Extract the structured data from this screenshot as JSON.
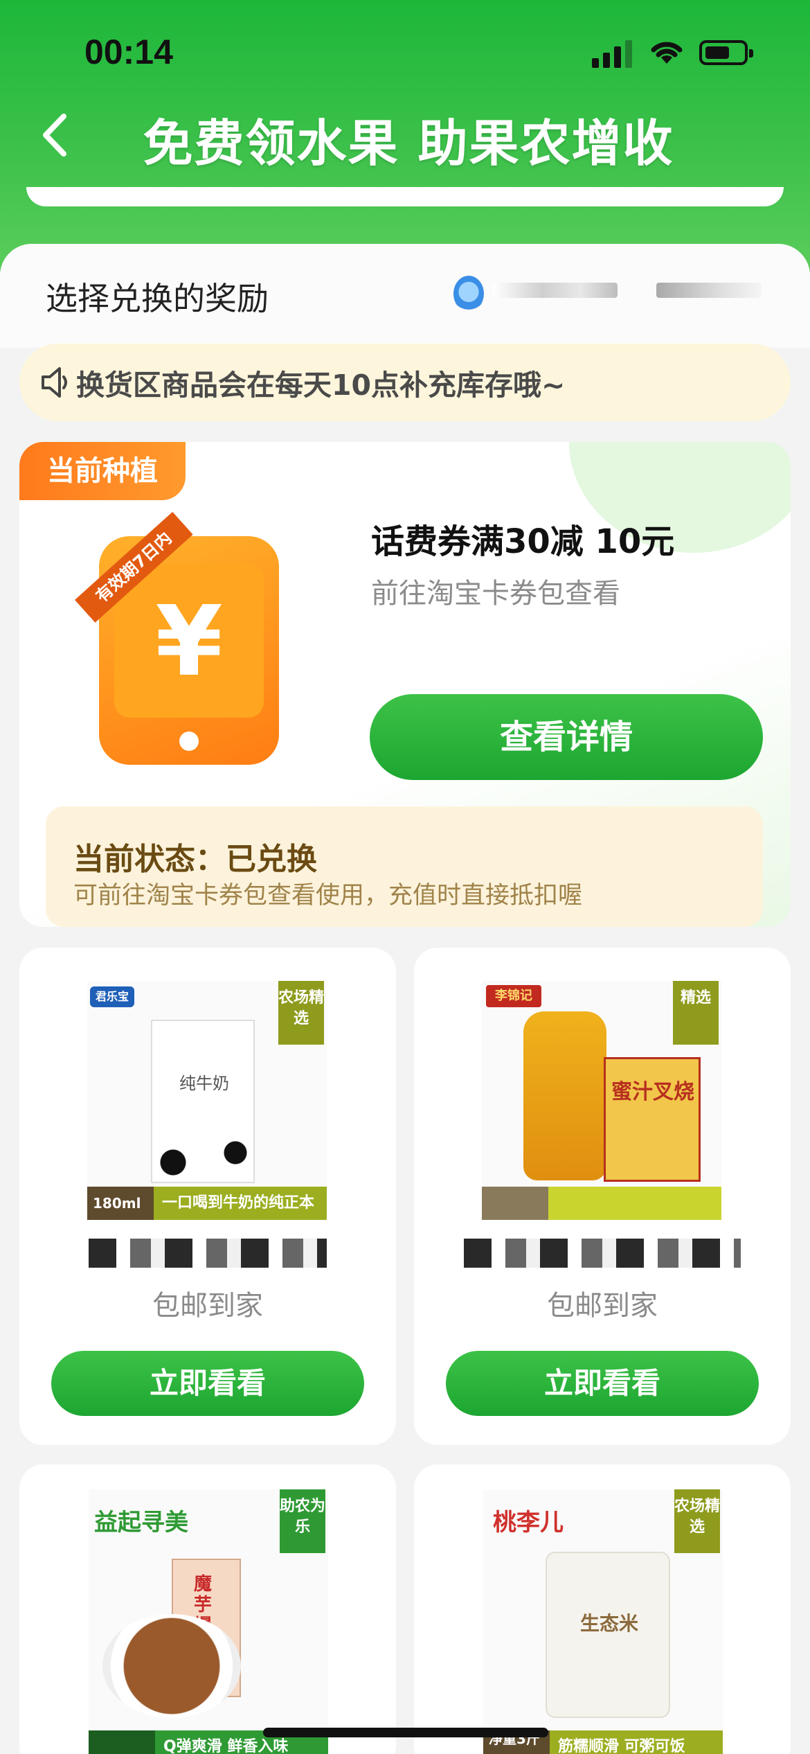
{
  "status_bar": {
    "time": "00:14"
  },
  "header": {
    "title": "免费领水果 助果农增收"
  },
  "section": {
    "title": "选择兑换的奖励"
  },
  "notice": {
    "text": "换货区商品会在每天10点补充库存哦~"
  },
  "current_plant": {
    "tag": "当前种植",
    "ribbon": "有效期7日内",
    "yuan_symbol": "¥",
    "prize_title": "话费券满30减 10元",
    "prize_sub": "前往淘宝卡券包查看",
    "detail_button": "查看详情",
    "status_title": "当前状态：已兑换",
    "status_desc": "可前往淘宝卡券包查看使用，充值时直接抵扣喔"
  },
  "products": [
    {
      "badge": "农场精选",
      "strip_text": "一口喝到牛奶的纯正本味",
      "strip_left": "180ml",
      "subtitle": "包邮到家",
      "button": "立即看看",
      "brand": "君乐宝",
      "pack_text": "纯牛奶"
    },
    {
      "badge": "精选",
      "strip_text": "",
      "strip_left": "",
      "subtitle": "包邮到家",
      "button": "立即看看",
      "brand": "李锦记",
      "pack_text": "蜜汁叉烧"
    },
    {
      "badge": "助农为乐",
      "strip_text": "Q弹爽滑 鲜香入味",
      "strip_left": "",
      "subtitle": "",
      "button": "",
      "brand": "益起寻美",
      "pack_text": "魔芋爆肚"
    },
    {
      "badge": "农场精选",
      "strip_text": "筋糯顺滑 可粥可饭",
      "strip_left": "净重3斤",
      "subtitle": "",
      "button": "",
      "brand": "桃李儿",
      "pack_text": "生态米"
    }
  ],
  "colors": {
    "primary_green": "#1ca631",
    "header_green": "#1db73a",
    "tag_orange": "#ff7a1c",
    "notice_bg": "#fdf6dc"
  }
}
